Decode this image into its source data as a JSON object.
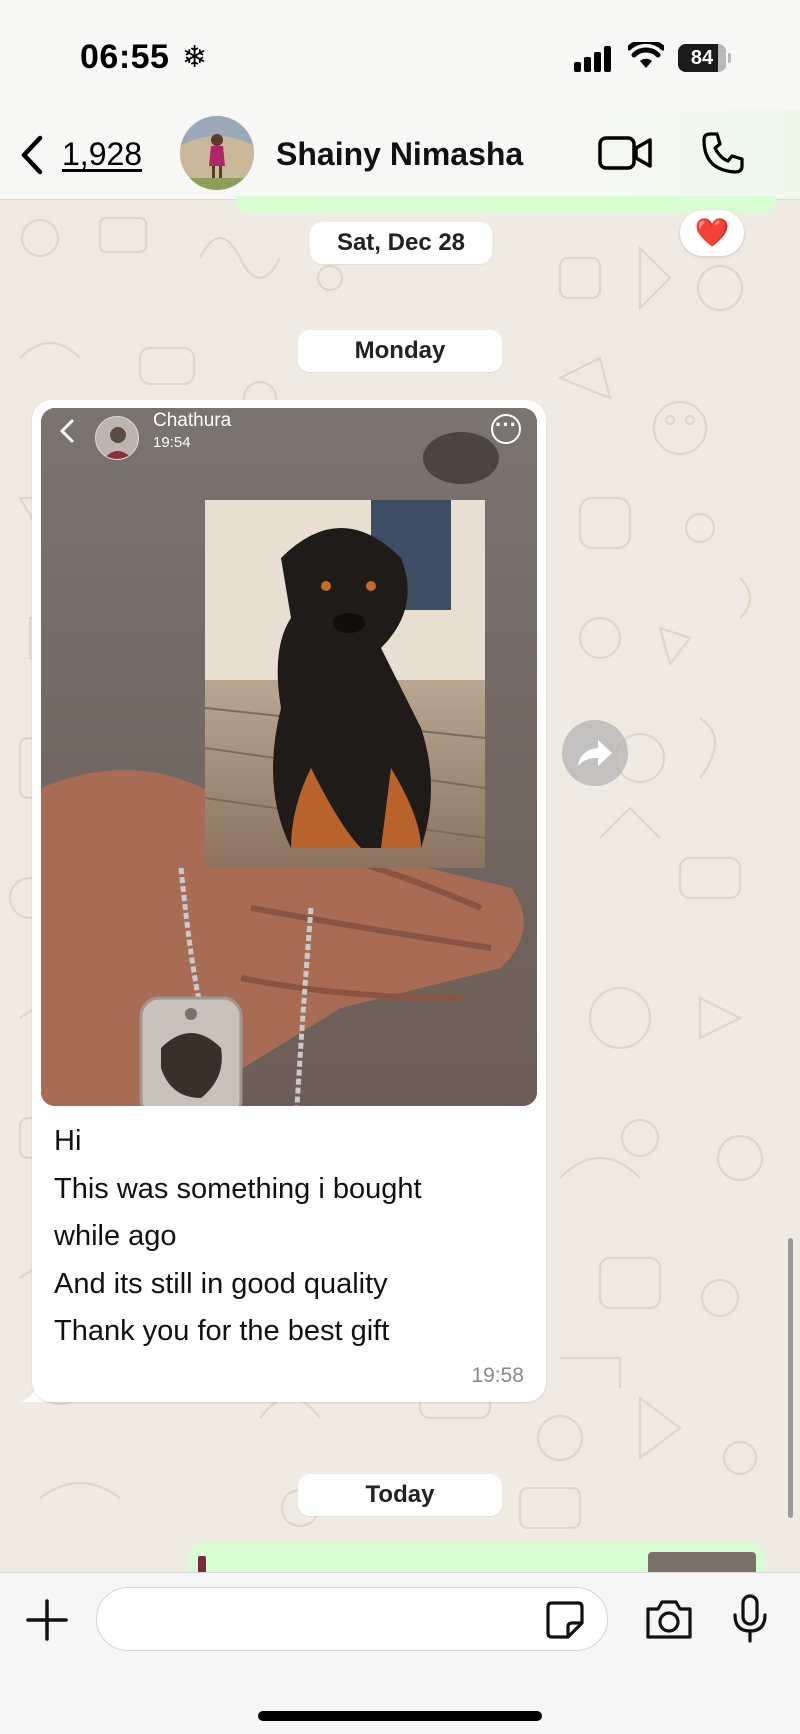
{
  "status_bar": {
    "time": "06:55",
    "focus_glyph": "❄",
    "battery": "84",
    "battery_level": 0.84
  },
  "header": {
    "back_count": "1,928",
    "contact_name": "Shainy Nimasha"
  },
  "date_pills": {
    "first": "Sat, Dec 28",
    "second": "Monday",
    "third": "Today"
  },
  "reaction": {
    "emoji": "❤️"
  },
  "message": {
    "story_author": "Chathura",
    "story_time": "19:54",
    "lines": [
      "Hi",
      "This was something i bought",
      "while ago",
      "And its still in good quality",
      "Thank you for the best gift"
    ],
    "time": "19:58"
  },
  "input": {
    "placeholder": ""
  },
  "colors": {
    "outgoing_bubble": "#d9fdd3",
    "incoming_bubble": "#ffffff",
    "wallpaper": "#f0ebe2",
    "heart": "#e0262f"
  },
  "icons": [
    "back-chevron-icon",
    "video-call-icon",
    "phone-icon",
    "forward-icon",
    "plus-icon",
    "sticker-icon",
    "camera-icon",
    "microphone-icon",
    "signal-icon",
    "wifi-icon",
    "battery-icon"
  ]
}
